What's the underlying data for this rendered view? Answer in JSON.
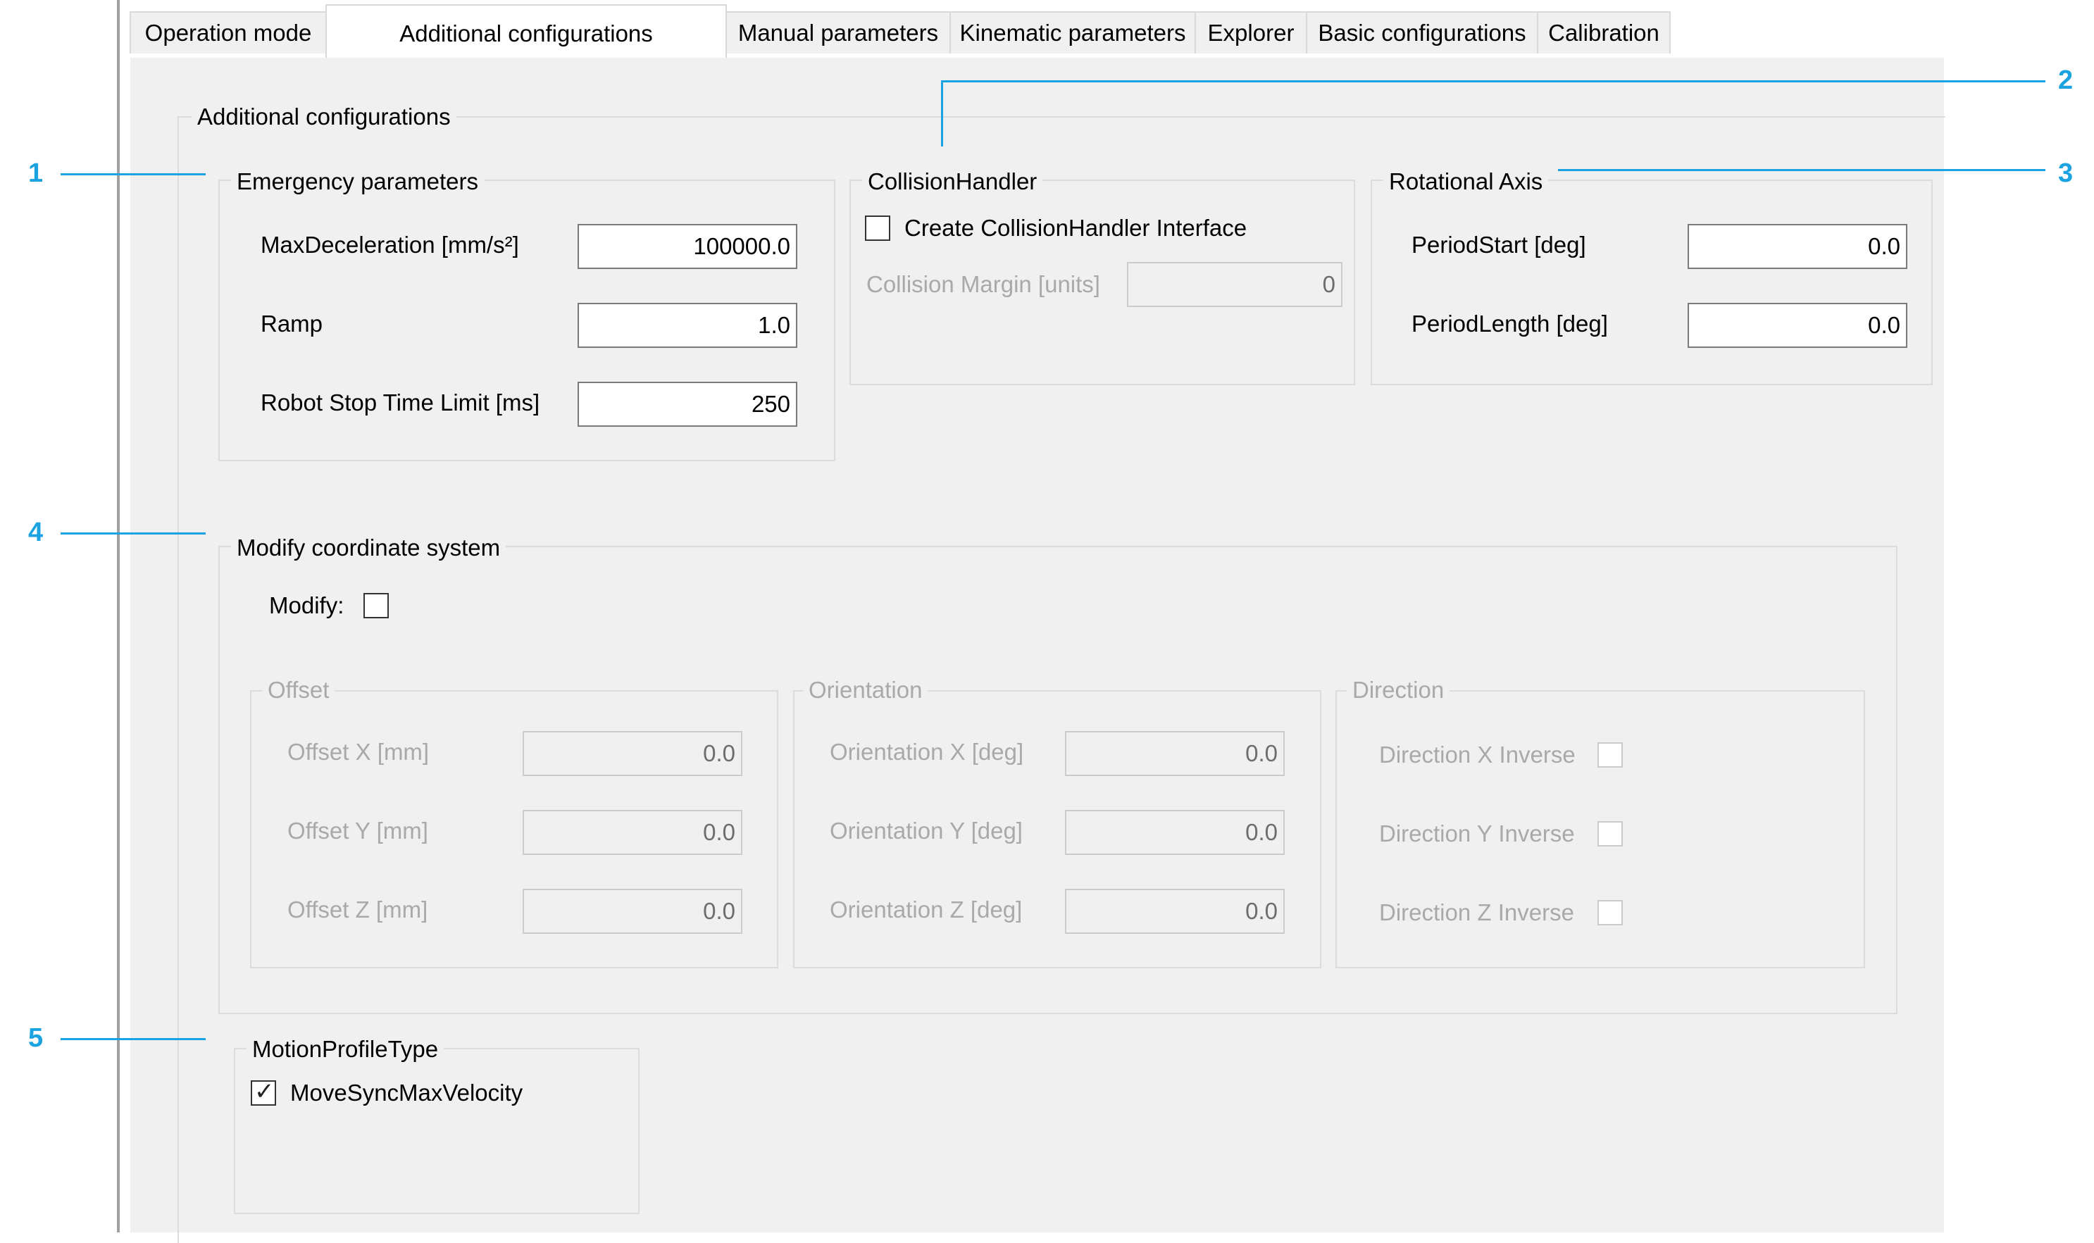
{
  "tabs": [
    {
      "label": "Operation mode"
    },
    {
      "label": "Additional configurations"
    },
    {
      "label": "Manual parameters"
    },
    {
      "label": "Kinematic parameters"
    },
    {
      "label": "Explorer"
    },
    {
      "label": "Basic configurations"
    },
    {
      "label": "Calibration"
    }
  ],
  "active_tab": "Additional configurations",
  "outer_group": {
    "title": "Additional configurations"
  },
  "emergency": {
    "title": "Emergency parameters",
    "max_decel_label": "MaxDeceleration [mm/s²]",
    "max_decel_value": "100000.0",
    "ramp_label": "Ramp",
    "ramp_value": "1.0",
    "stop_limit_label": "Robot Stop Time Limit [ms]",
    "stop_limit_value": "250"
  },
  "collision": {
    "title": "CollisionHandler",
    "create_label": "Create CollisionHandler Interface",
    "create_checked": false,
    "margin_label": "Collision Margin [units]",
    "margin_value": "0"
  },
  "rotational": {
    "title": "Rotational Axis",
    "period_start_label": "PeriodStart [deg]",
    "period_start_value": "0.0",
    "period_length_label": "PeriodLength [deg]",
    "period_length_value": "0.0"
  },
  "modify_cs": {
    "title": "Modify coordinate system",
    "modify_label": "Modify:",
    "modify_checked": false,
    "offset": {
      "title": "Offset",
      "x_label": "Offset X [mm]",
      "x_value": "0.0",
      "y_label": "Offset Y [mm]",
      "y_value": "0.0",
      "z_label": "Offset Z [mm]",
      "z_value": "0.0"
    },
    "orientation": {
      "title": "Orientation",
      "x_label": "Orientation X [deg]",
      "x_value": "0.0",
      "y_label": "Orientation Y [deg]",
      "y_value": "0.0",
      "z_label": "Orientation Z [deg]",
      "z_value": "0.0"
    },
    "direction": {
      "title": "Direction",
      "x_label": "Direction X Inverse",
      "x_checked": false,
      "y_label": "Direction Y Inverse",
      "y_checked": false,
      "z_label": "Direction Z Inverse",
      "z_checked": false
    }
  },
  "motion_profile": {
    "title": "MotionProfileType",
    "move_sync_label": "MoveSyncMaxVelocity",
    "move_sync_checked": true
  },
  "callouts": [
    "1",
    "2",
    "3",
    "4",
    "5"
  ],
  "colors": {
    "callout": "#1aa3e0",
    "panel_bg": "#f0f0f0",
    "disabled_text": "#a9a9a9"
  }
}
